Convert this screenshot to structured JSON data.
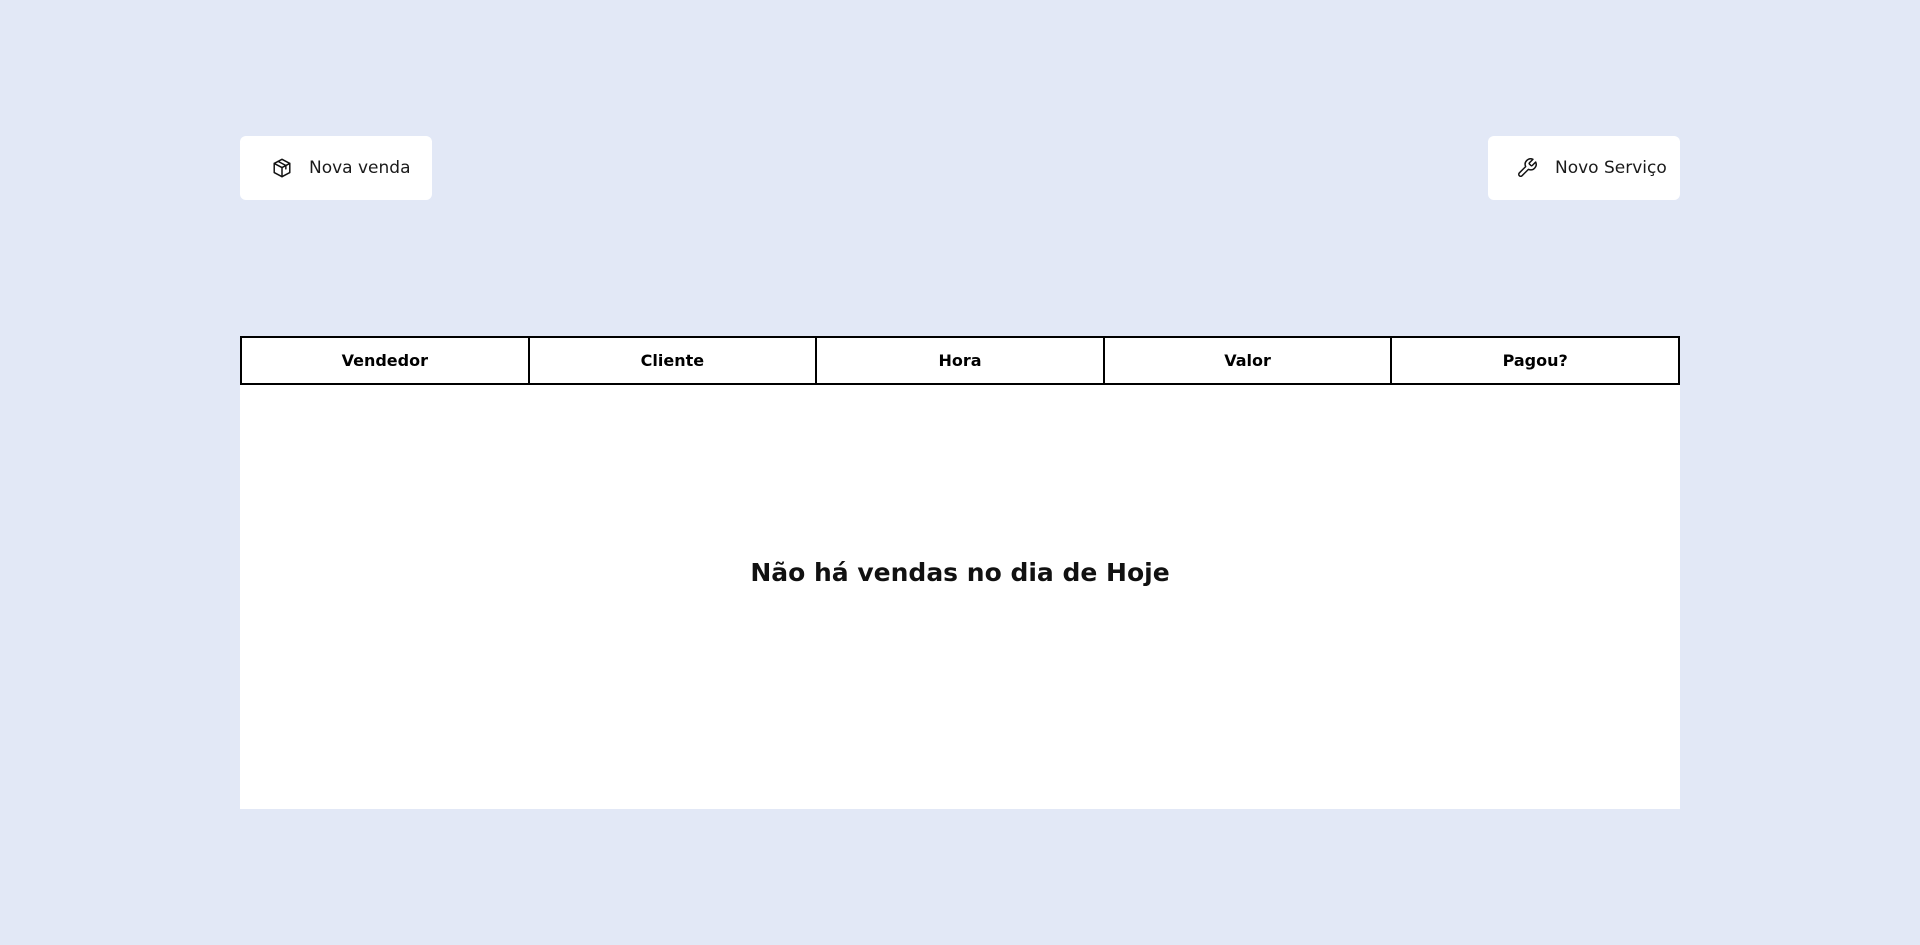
{
  "actions": {
    "new_sale": {
      "label": "Nova venda",
      "icon": "package-icon"
    },
    "new_service": {
      "label": "Novo Serviço",
      "icon": "wrench-icon"
    }
  },
  "sales_table": {
    "columns": [
      "Vendedor",
      "Cliente",
      "Hora",
      "Valor",
      "Pagou?"
    ],
    "rows": [],
    "empty_message": "Não há vendas no dia de Hoje"
  },
  "colors": {
    "background": "#e2e8f6",
    "surface": "#ffffff",
    "border": "#000000",
    "text": "#111111"
  }
}
